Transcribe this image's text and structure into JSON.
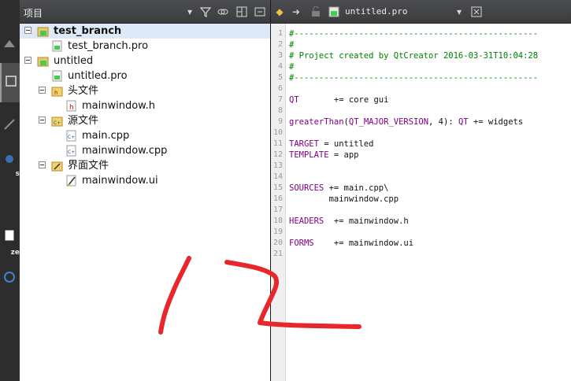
{
  "project_pane": {
    "title": "项目",
    "tree": [
      {
        "label": "test_branch",
        "level": 0,
        "type": "project",
        "bold": true,
        "selected": true,
        "expander": true
      },
      {
        "label": "test_branch.pro",
        "level": 1,
        "type": "pro"
      },
      {
        "label": "untitled",
        "level": 0,
        "type": "project",
        "expander": true
      },
      {
        "label": "untitled.pro",
        "level": 1,
        "type": "pro"
      },
      {
        "label": "头文件",
        "level": 1,
        "type": "folder-headers",
        "expander": true
      },
      {
        "label": "mainwindow.h",
        "level": 2,
        "type": "h"
      },
      {
        "label": "源文件",
        "level": 1,
        "type": "folder-sources",
        "expander": true
      },
      {
        "label": "main.cpp",
        "level": 2,
        "type": "cpp"
      },
      {
        "label": "mainwindow.cpp",
        "level": 2,
        "type": "cpp"
      },
      {
        "label": "界面文件",
        "level": 1,
        "type": "folder-forms",
        "expander": true
      },
      {
        "label": "mainwindow.ui",
        "level": 2,
        "type": "ui"
      }
    ]
  },
  "modebar": {
    "labels": [
      "s",
      "ze"
    ]
  },
  "editor": {
    "filename": "untitled.pro",
    "lines": [
      {
        "n": "1",
        "parts": [
          {
            "t": "#-------------------------------------------------",
            "c": "cm"
          }
        ]
      },
      {
        "n": "2",
        "parts": [
          {
            "t": "#",
            "c": "cm"
          }
        ]
      },
      {
        "n": "3",
        "parts": [
          {
            "t": "# Project created by QtCreator 2016-03-31T10:04:28",
            "c": "cm"
          }
        ]
      },
      {
        "n": "4",
        "parts": [
          {
            "t": "#",
            "c": "cm"
          }
        ]
      },
      {
        "n": "5",
        "parts": [
          {
            "t": "#-------------------------------------------------",
            "c": "cm"
          }
        ]
      },
      {
        "n": "6",
        "parts": []
      },
      {
        "n": "7",
        "parts": [
          {
            "t": "QT",
            "c": "kw"
          },
          {
            "t": "       += core gui",
            "c": ""
          }
        ]
      },
      {
        "n": "8",
        "parts": []
      },
      {
        "n": "9",
        "parts": [
          {
            "t": "greaterThan",
            "c": "kw"
          },
          {
            "t": "(",
            "c": ""
          },
          {
            "t": "QT_MAJOR_VERSION",
            "c": "kw"
          },
          {
            "t": ", 4): ",
            "c": ""
          },
          {
            "t": "QT",
            "c": "kw"
          },
          {
            "t": " += widgets",
            "c": ""
          }
        ]
      },
      {
        "n": "10",
        "parts": []
      },
      {
        "n": "11",
        "parts": [
          {
            "t": "TARGET",
            "c": "kw"
          },
          {
            "t": " = untitled",
            "c": ""
          }
        ]
      },
      {
        "n": "12",
        "parts": [
          {
            "t": "TEMPLATE",
            "c": "kw"
          },
          {
            "t": " = app",
            "c": ""
          }
        ]
      },
      {
        "n": "13",
        "parts": []
      },
      {
        "n": "14",
        "parts": []
      },
      {
        "n": "15",
        "parts": [
          {
            "t": "SOURCES",
            "c": "kw"
          },
          {
            "t": " += main.cpp\\",
            "c": ""
          }
        ]
      },
      {
        "n": "16",
        "parts": [
          {
            "t": "        mainwindow.cpp",
            "c": ""
          }
        ]
      },
      {
        "n": "17",
        "parts": []
      },
      {
        "n": "18",
        "parts": [
          {
            "t": "HEADERS",
            "c": "kw"
          },
          {
            "t": "  += mainwindow.h",
            "c": ""
          }
        ]
      },
      {
        "n": "19",
        "parts": []
      },
      {
        "n": "20",
        "parts": [
          {
            "t": "FORMS",
            "c": "kw"
          },
          {
            "t": "    += mainwindow.ui",
            "c": ""
          }
        ]
      },
      {
        "n": "21",
        "parts": []
      }
    ]
  },
  "annotation": {
    "text": "12",
    "color": "#e8272c"
  },
  "colors": {
    "accent_selected": "#dde9f7",
    "comment": "#008000",
    "keyword": "#800080",
    "toolbar": "#3f4143"
  }
}
